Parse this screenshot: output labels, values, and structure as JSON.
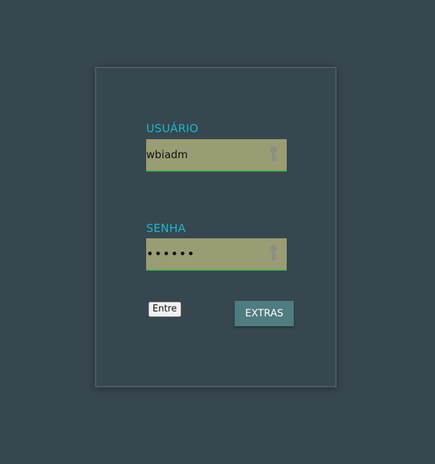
{
  "login": {
    "user_label": "USUÁRIO",
    "user_value": "wbiadm",
    "password_label": "SENHA",
    "password_value": "••••••",
    "submit_label": "Entre",
    "extras_label": "EXTRAS"
  },
  "icons": {
    "user_field_icon": "key-icon",
    "password_field_icon": "key-icon"
  },
  "colors": {
    "background": "#37474f",
    "label": "#1cb7cf",
    "field_background": "#9a9d74",
    "field_underline": "#4caf50",
    "extras_button": "#4f7c81"
  }
}
